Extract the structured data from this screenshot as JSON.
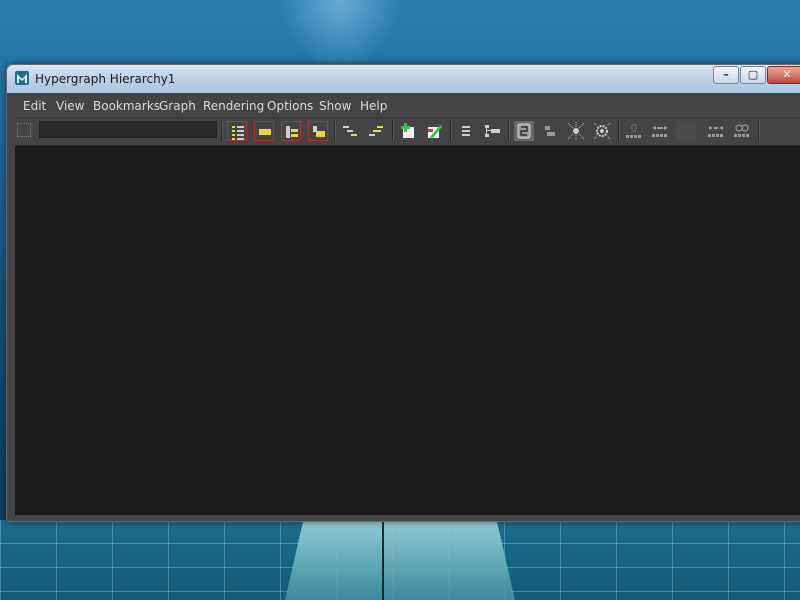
{
  "window": {
    "title": "Hypergraph Hierarchy1",
    "controls": {
      "minimize": "–",
      "maximize": "▢",
      "close": "✕"
    }
  },
  "menubar": {
    "items": [
      {
        "label": "Edit"
      },
      {
        "label": "View"
      },
      {
        "label": "Bookmarks"
      },
      {
        "label": "Graph"
      },
      {
        "label": "Rendering"
      },
      {
        "label": "Options"
      },
      {
        "label": "Show"
      },
      {
        "label": "Help"
      }
    ]
  },
  "toolbar": {
    "search_value": "",
    "icons": [
      "list-hierarchy-icon",
      "bookmark-yellow-icon",
      "frame-hierarchy-icon",
      "frame-selection-icon",
      "layout-left-icon",
      "layout-right-icon",
      "add-bookmark-icon",
      "edit-bookmark-icon",
      "graph-lines-icon",
      "scene-hierarchy-icon",
      "input-connections-icon",
      "output-connections-icon",
      "expand-nodes-icon",
      "collapse-nodes-icon",
      "zero-icon",
      "dotted-arrows-icon",
      "dotted-merge-icon",
      "link-dots-icon"
    ]
  },
  "colors": {
    "window_bg": "#444444",
    "canvas_bg": "#1c1c1c",
    "menu_text": "#dcdcdc",
    "accent_yellow": "#e5d84a",
    "accent_red": "#b03030"
  }
}
